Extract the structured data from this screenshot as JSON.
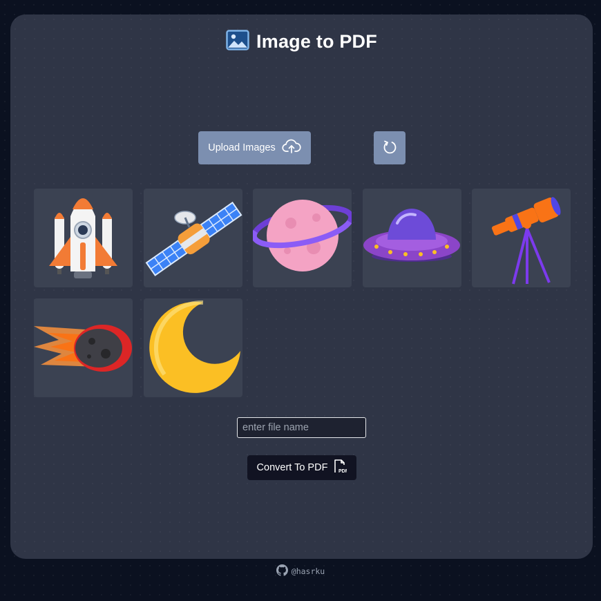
{
  "header": {
    "title": "Image to PDF",
    "icon": "image-icon"
  },
  "toolbar": {
    "upload_label": "Upload Images",
    "upload_icon": "cloud-upload-icon",
    "reset_icon": "refresh-icon"
  },
  "images": [
    {
      "name": "rocket"
    },
    {
      "name": "satellite"
    },
    {
      "name": "planet"
    },
    {
      "name": "ufo"
    },
    {
      "name": "telescope"
    },
    {
      "name": "comet"
    },
    {
      "name": "moon"
    }
  ],
  "form": {
    "filename_placeholder": "enter file name",
    "filename_value": "",
    "convert_label": "Convert To PDF",
    "convert_icon": "pdf-file-icon"
  },
  "footer": {
    "handle": "@hasrku",
    "icon": "github-icon"
  },
  "colors": {
    "page_bg": "#0b1120",
    "card_bg": "#2f3546",
    "tile_bg": "#3b4252",
    "button_bg": "#7c8fb0",
    "convert_bg": "#111322"
  }
}
